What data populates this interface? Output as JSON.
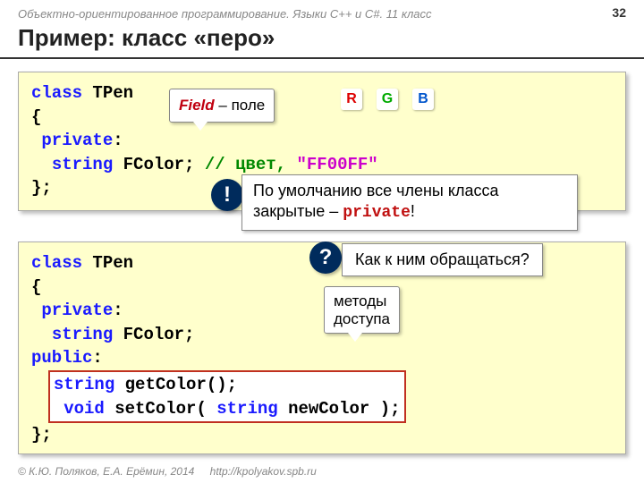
{
  "breadcrumb": "Объектно-ориентированное программирование. Языки C++ и C#. 11 класс",
  "page_num": "32",
  "title": "Пример: класс «перо»",
  "box1": {
    "l1a": "class",
    "l1b": "TPen",
    "l2": "{",
    "l3a": "private",
    "l3b": ":",
    "l4a": "string",
    "l4b": " FColor; ",
    "l4c": "// цвет, ",
    "l4d": "\"FF00FF\"",
    "l5": "};",
    "field_label_a": "Field",
    "field_label_b": " – поле",
    "r": "R",
    "g": "G",
    "b": "B"
  },
  "bang": {
    "mark": "!",
    "text_a": "По умолчанию все члены класса",
    "text_b": "закрытые – ",
    "text_c": "private",
    "text_d": "!"
  },
  "q": {
    "mark": "?",
    "text": "Как к ним обращаться?"
  },
  "access": "методы\nдоступа",
  "box2": {
    "l1a": "class",
    "l1b": "TPen",
    "l2": "{",
    "l3a": "private",
    "l3b": ":",
    "l4a": "string",
    "l4b": " FColor;",
    "l5a": "public",
    "l5b": ":",
    "l6a": "string",
    "l6b": " getColor();",
    "l7a": "void",
    "l7b": " setColor( ",
    "l7c": "string",
    "l7d": " newColor );",
    "l8": "};"
  },
  "footer": {
    "copy": "© К.Ю. Поляков, Е.А. Ерёмин, 2014",
    "url": "http://kpolyakov.spb.ru"
  }
}
